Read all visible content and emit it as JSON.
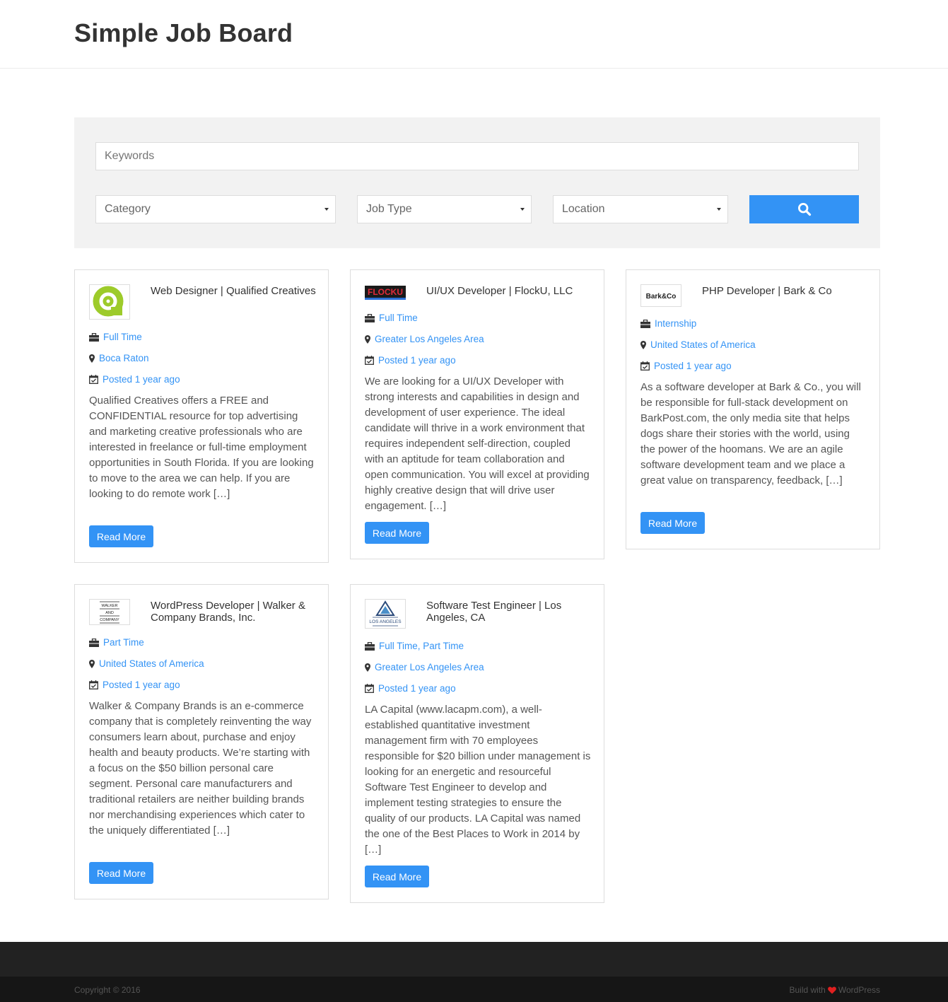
{
  "site": {
    "title": "Simple Job Board"
  },
  "search": {
    "keywords_placeholder": "Keywords",
    "category": "Category",
    "job_type": "Job Type",
    "location": "Location",
    "search_icon": "search-icon"
  },
  "jobs": [
    {
      "logo": "Qualified Creatives logo",
      "title": "Web Designer | Qualified Creatives",
      "type": "Full Time",
      "location": "Boca Raton",
      "posted": "Posted 1 year ago",
      "description": "Qualified Creatives offers a FREE and CONFIDENTIAL resource for top advertising and marketing creative professionals who are interested in freelance or full-time employment opportunities in South Florida. If you are looking to move to the area we can help. If you are looking to do remote work […]",
      "button": "Read More"
    },
    {
      "logo": "FlockU logo",
      "logo_text": "FLOCKU",
      "title": "UI/UX Developer | FlockU, LLC",
      "type": "Full Time",
      "location": "Greater Los Angeles Area",
      "posted": "Posted 1 year ago",
      "description": "We are looking for a UI/UX Developer with strong interests and capabilities in design and development of user experience.  The ideal candidate will thrive in a work environment that requires independent self-direction, coupled with an aptitude for team collaboration and open communication.  You will excel at providing highly creative design that will drive user engagement.  […]",
      "button": "Read More"
    },
    {
      "logo": "Bark & Co logo",
      "logo_text": "Bark&Co",
      "title": "PHP Developer | Bark & Co",
      "type": "Internship",
      "location": "United States of America",
      "posted": "Posted 1 year ago",
      "description": "As a software developer at Bark & Co., you will be responsible for full-stack development on BarkPost.com, the only media site that helps dogs share their stories with the world, using the power of the hoomans. We are an agile software development team and we place a great value on transparency, feedback, […]",
      "button": "Read More"
    },
    {
      "logo": "Walker and Company logo",
      "logo_lines": [
        "WALKER",
        "AND",
        "COMPANY"
      ],
      "title": "WordPress Developer | Walker & Company Brands, Inc.",
      "type": "Part Time",
      "location": "United States of America",
      "posted": "Posted 1 year ago",
      "description": "Walker & Company Brands is an e-commerce company that is completely reinventing the way consumers learn about, purchase and enjoy health and beauty products. We’re starting with a focus on the $50 billion personal care segment. Personal care manufacturers and traditional retailers are neither building brands nor merchandising experiences which cater to the uniquely differentiated […]",
      "button": "Read More"
    },
    {
      "logo": "LA Capital logo",
      "logo_text": "LOS ANGELES",
      "title": "Software Test Engineer | Los Angeles, CA",
      "type": "Full Time, Part Time",
      "location": "Greater Los Angeles Area",
      "posted": "Posted 1 year ago",
      "description": "LA Capital (www.lacapm.com), a well-established quantitative investment management firm with 70 employees responsible for $20 billion under management is looking for an energetic and resourceful Software Test Engineer to develop and implement testing strategies to ensure the quality of our products. LA Capital was named the one of the Best Places to Work in 2014 by […]",
      "button": "Read More"
    }
  ],
  "footer": {
    "copyright": "Copyright © 2016",
    "built_prefix": "Build with",
    "built_suffix": "WordPress",
    "heart_color": "#e02020"
  },
  "colors": {
    "accent": "#3393f5"
  }
}
